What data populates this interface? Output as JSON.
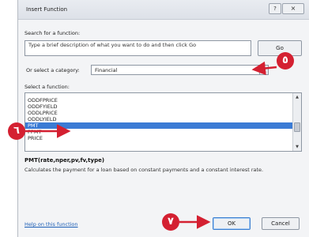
{
  "dialog": {
    "title": "Insert Function",
    "help_icon": "?",
    "close_icon": "×"
  },
  "search": {
    "label": "Search for a function:",
    "value": "Type a brief description of what you want to do and then click Go",
    "go_label": "Go"
  },
  "category": {
    "label": "Or select a category:",
    "value": "Financial",
    "dropdown_icon": "▼"
  },
  "functions": {
    "label": "Select a function:",
    "items": [
      "ODDFPRICE",
      "ODDFYIELD",
      "ODDLPRICE",
      "ODDLYIELD",
      "PMT",
      "PPMT",
      "PRICE"
    ],
    "selected_index": 4
  },
  "syntax": "PMT(rate,nper,pv,fv,type)",
  "description": "Calculates the payment for a loan based on constant payments and a constant interest rate.",
  "help_link": "Help on this function",
  "buttons": {
    "ok": "OK",
    "cancel": "Cancel"
  },
  "callouts": {
    "c5": "٥",
    "c6": "٦",
    "c7": "٧",
    "color": "#d42031"
  },
  "colors": {
    "selection": "#3a7bd5",
    "callout": "#d42031",
    "link": "#1a5db5"
  }
}
